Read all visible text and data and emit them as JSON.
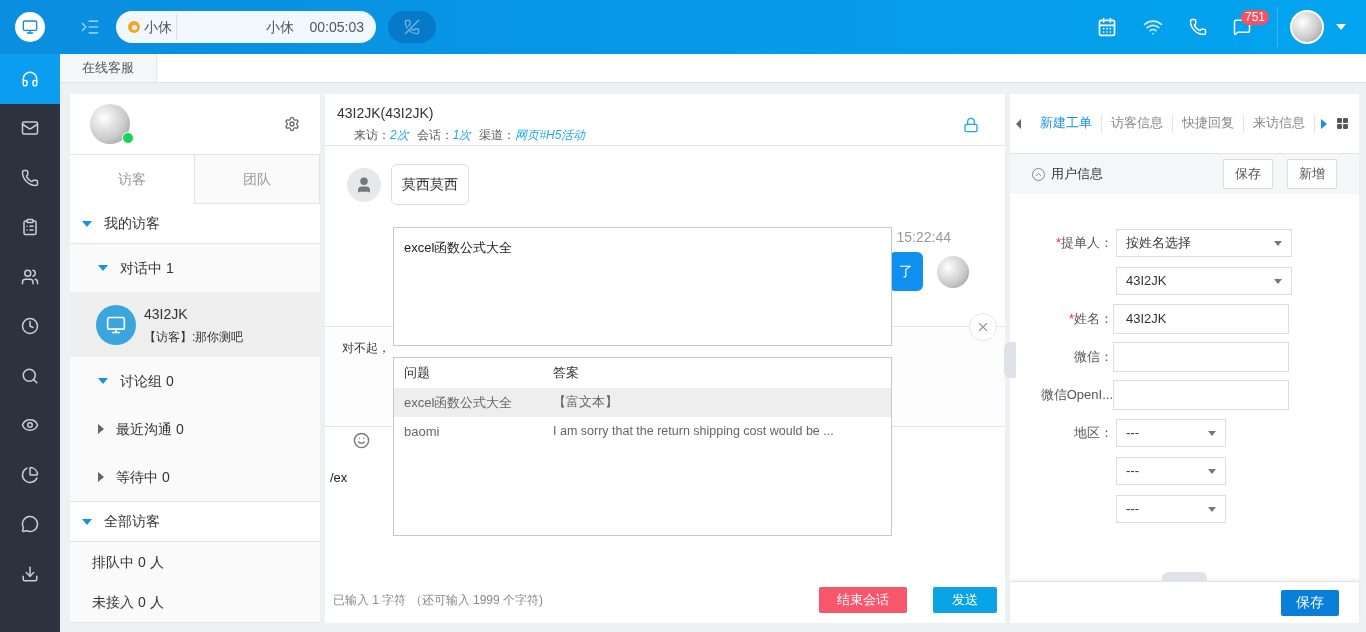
{
  "nav": [
    {
      "selected": true
    },
    {
      "selected": false
    },
    {
      "selected": false
    },
    {
      "selected": false
    },
    {
      "selected": false
    },
    {
      "selected": false
    },
    {
      "selected": false
    },
    {
      "selected": false
    },
    {
      "selected": false
    },
    {
      "selected": false
    },
    {
      "selected": false
    }
  ],
  "topbar": {
    "status": "小休",
    "status_detail": "小休",
    "timer": "00:05:03",
    "badge": "751"
  },
  "page_tabs": [
    {
      "label": "在线客服",
      "selected": true
    }
  ],
  "left": {
    "tabs": [
      {
        "label": "访客",
        "selected": true
      },
      {
        "label": "团队",
        "selected": false
      }
    ],
    "tree": [
      {
        "label": "我的访客",
        "expanded": true,
        "kind": "group",
        "children": [
          {
            "label": "对话中 1",
            "expanded": true,
            "kind": "sub",
            "children": [
              {
                "kind": "visitor",
                "name": "43I2JK",
                "preview": "【访客】:那你测吧",
                "selected": true
              }
            ]
          },
          {
            "label": "讨论组 0",
            "expanded": true,
            "kind": "sub"
          },
          {
            "label": "最近沟通 0",
            "expanded": false,
            "kind": "sub"
          },
          {
            "label": "等待中 0",
            "expanded": false,
            "kind": "sub"
          }
        ]
      },
      {
        "label": "全部访客",
        "expanded": true,
        "kind": "group",
        "children": [
          {
            "kind": "plain",
            "label": "排队中 0 人"
          },
          {
            "kind": "plain",
            "label": "未接入 0 人"
          }
        ]
      }
    ]
  },
  "chat": {
    "title": "43I2JK(43I2JK)",
    "stats": [
      {
        "label": "来访：",
        "value": "2次"
      },
      {
        "label": "会话：",
        "value": "1次"
      },
      {
        "label": "渠道：",
        "value": "网页#H5活动"
      }
    ],
    "messages": [
      {
        "kind": "in",
        "text": "莫西莫西"
      },
      {
        "kind": "out",
        "time": "15:22:44",
        "text": "了"
      }
    ],
    "robot_reply": "对不起，",
    "input": "/ex",
    "counter": "已输入 1 字符 （还可输入 1999 个字符)",
    "end_button": "结束会话",
    "send_button": "发送",
    "preview": "excel函数公式大全",
    "suggest_columns": [
      "问题",
      "答案"
    ],
    "suggestions": [
      {
        "question": "excel函数公式大全",
        "answer": "【富文本】",
        "selected": true
      },
      {
        "question": "baomi",
        "answer": "I am sorry that the return shipping cost would be ...",
        "selected": false
      }
    ]
  },
  "right": {
    "tabs": [
      {
        "label": "新建工单",
        "selected": true
      },
      {
        "label": "访客信息",
        "selected": false
      },
      {
        "label": "快捷回复",
        "selected": false
      },
      {
        "label": "来访信息",
        "selected": false
      }
    ],
    "section": "用户信息",
    "save": "保存",
    "add": "新增",
    "fields": [
      {
        "mark": "*",
        "label": "提单人：",
        "kind": "select",
        "value": "按姓名选择"
      },
      {
        "kind": "select",
        "value": "43I2JK"
      },
      {
        "mark": "*",
        "label": "姓名：",
        "kind": "input",
        "value": "43I2JK"
      },
      {
        "label": "微信：",
        "kind": "input"
      },
      {
        "label": "微信OpenI...",
        "kind": "input"
      },
      {
        "label": "地区：",
        "kind": "small-select",
        "value": "---"
      },
      {
        "kind": "small-select",
        "value": "---"
      },
      {
        "kind": "small-select",
        "value": "---"
      }
    ],
    "footer_save": "保存"
  }
}
